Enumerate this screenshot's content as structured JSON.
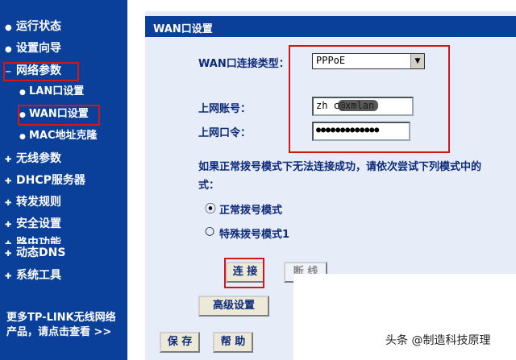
{
  "sidebar": {
    "items": [
      {
        "label": "运行状态"
      },
      {
        "label": "设置向导"
      },
      {
        "label": "网络参数"
      },
      {
        "label": "LAN口设置"
      },
      {
        "label": "WAN口设置"
      },
      {
        "label": "MAC地址克隆"
      },
      {
        "label": "无线参数"
      },
      {
        "label": "DHCP服务器"
      },
      {
        "label": "转发规则"
      },
      {
        "label": "安全设置"
      },
      {
        "label": "路由功能"
      },
      {
        "label": "动态DNS"
      },
      {
        "label": "系统工具"
      }
    ],
    "more_line1": "更多TP-LINK无线网络",
    "more_line2": "产品，请点击查看 >>"
  },
  "main": {
    "title": "WAN口设置",
    "conn_type_label": "WAN口连接类型：",
    "conn_type_value": "PPPoE",
    "account_label": "上网账号：",
    "account_value": "zh           c@xmlan",
    "password_label": "上网口令：",
    "password_value": "●●●●●●●●●●●●●",
    "hint_line1": "如果正常拨号模式下无法连接成功，请依次尝试下列模式中的",
    "hint_line2": "式：",
    "mode_normal": "正常拨号模式",
    "mode_special": "特殊拨号模式1",
    "connect_btn": "连 接",
    "disconnect_btn": "断 线",
    "advanced_btn": "高级设置",
    "save_btn": "保 存",
    "help_btn": "帮 助"
  },
  "watermark": "头条 @制造科技原理",
  "colors": {
    "nav_bg": "#0a3f9a",
    "highlight": "#d01818",
    "panel_bg": "#e6ecf8"
  }
}
